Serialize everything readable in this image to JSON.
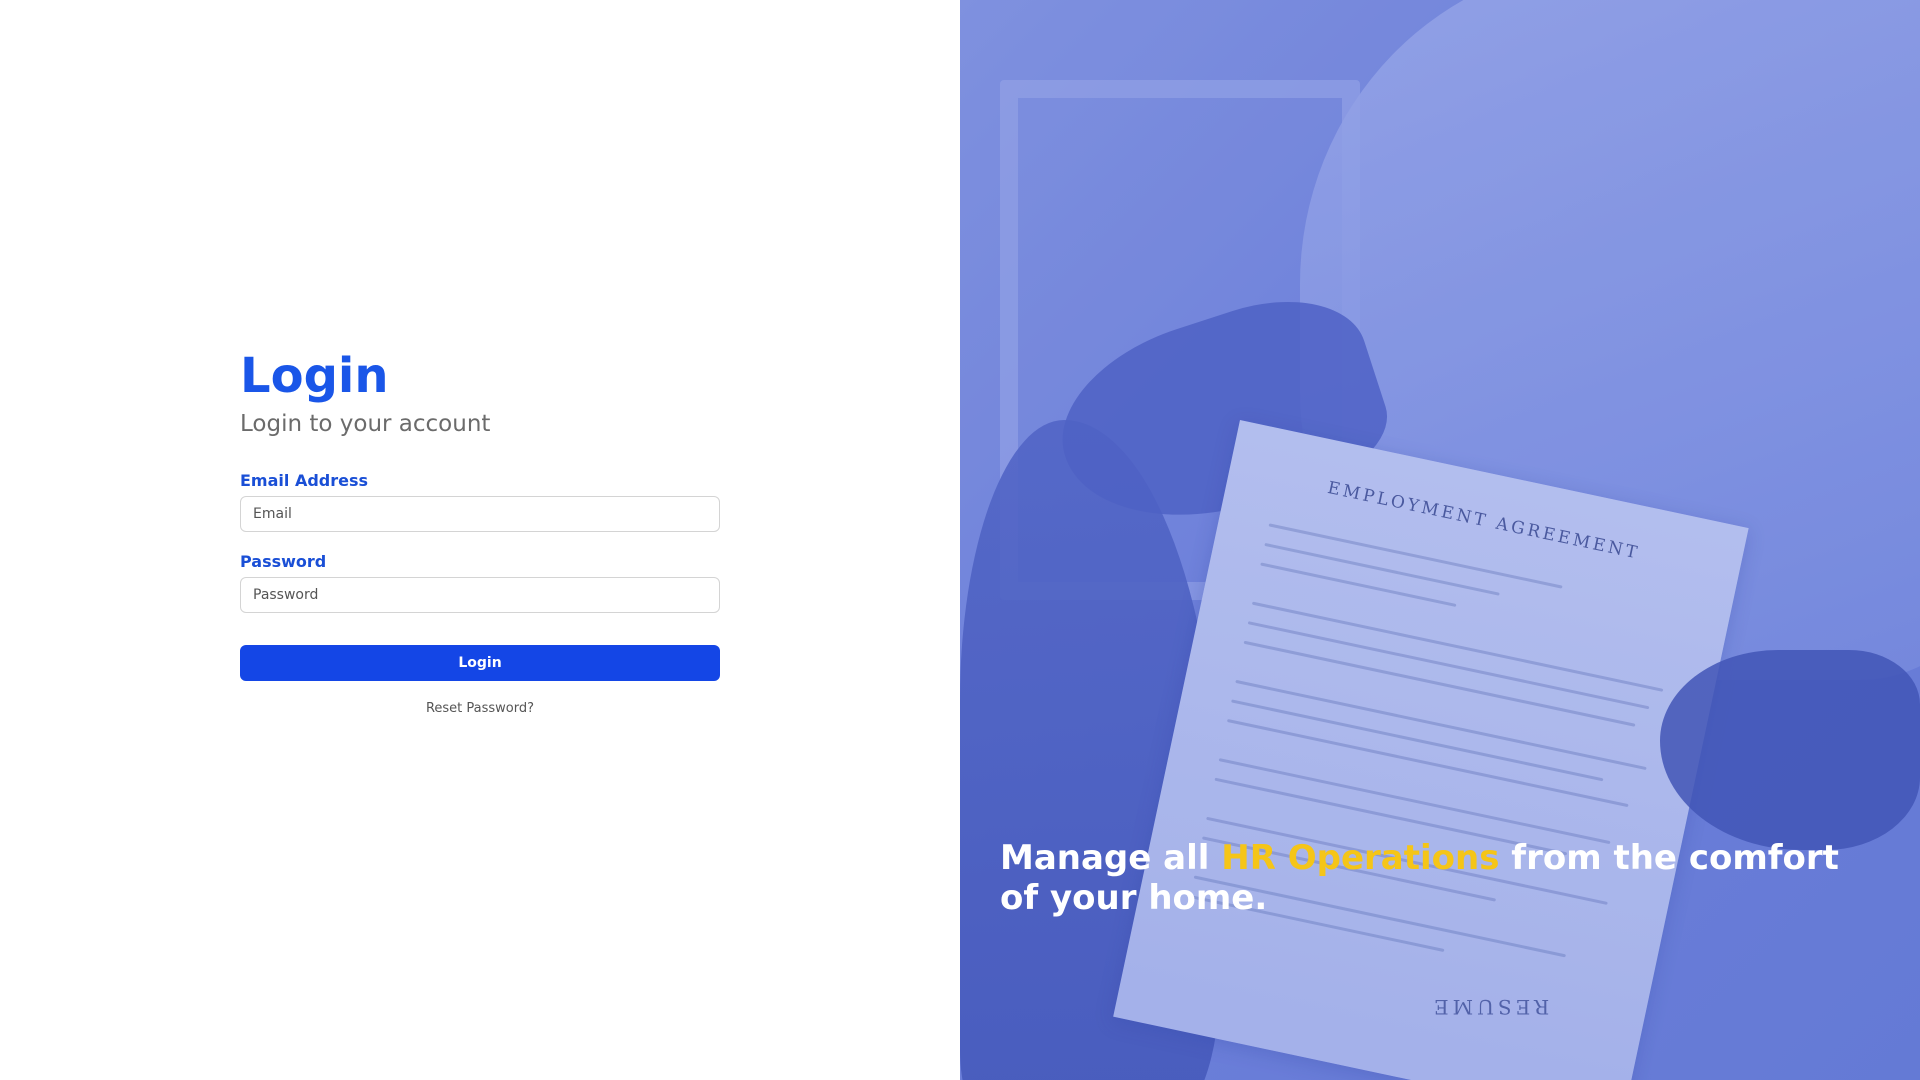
{
  "login": {
    "title": "Login",
    "subtitle": "Login to your account",
    "email_label": "Email Address",
    "email_placeholder": "Email",
    "email_value": "",
    "password_label": "Password",
    "password_placeholder": "Password",
    "password_value": "",
    "submit_label": "Login",
    "reset_link": "Reset Password?"
  },
  "hero": {
    "tagline_prefix": "Manage all ",
    "tagline_highlight": "HR Operations",
    "tagline_suffix": " from the comfort of your home.",
    "document_heading": "EMPLOYMENT AGREEMENT",
    "resume_text": "RESUME",
    "image_subject": "handshake-over-employment-agreement-photo"
  },
  "colors": {
    "primary": "#1a56e8",
    "button": "#1446e6",
    "highlight": "#f5c518",
    "overlay": "#6a7fd6"
  }
}
